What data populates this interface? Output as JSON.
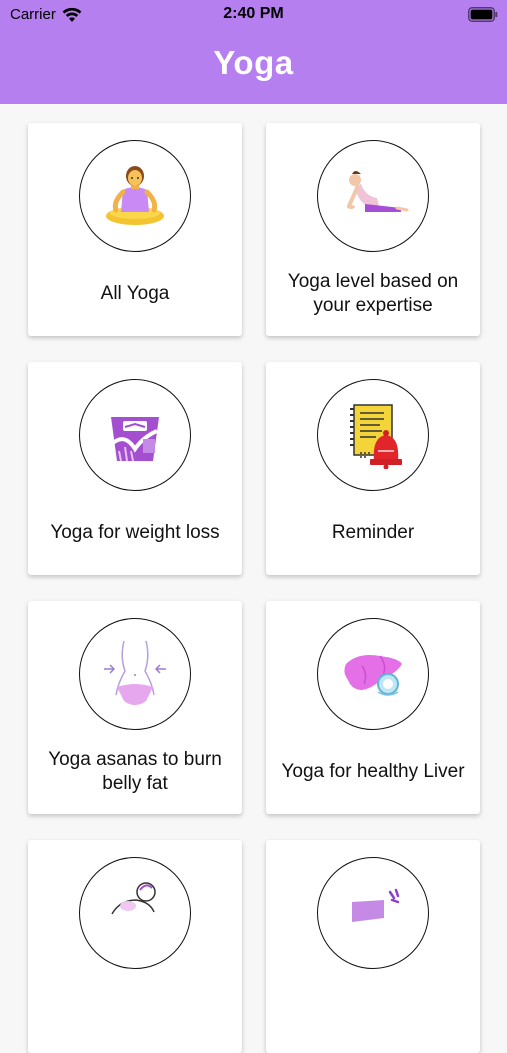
{
  "status_bar": {
    "carrier": "Carrier",
    "time": "2:40 PM"
  },
  "header": {
    "title": "Yoga",
    "background_color": "#b57ff0"
  },
  "cards": [
    {
      "label": "All Yoga",
      "icon": "meditating-woman-icon"
    },
    {
      "label": "Yoga level based on your expertise",
      "icon": "cobra-pose-icon"
    },
    {
      "label": "Yoga for weight loss",
      "icon": "weighing-scale-icon"
    },
    {
      "label": "Reminder",
      "icon": "reminder-notepad-bell-icon"
    },
    {
      "label": "Yoga asanas to burn belly fat",
      "icon": "waist-icon"
    },
    {
      "label": "Yoga for healthy Liver",
      "icon": "liver-icon"
    },
    {
      "label": "",
      "icon": "mother-baby-icon"
    },
    {
      "label": "",
      "icon": "yoga-mat-icon"
    }
  ]
}
